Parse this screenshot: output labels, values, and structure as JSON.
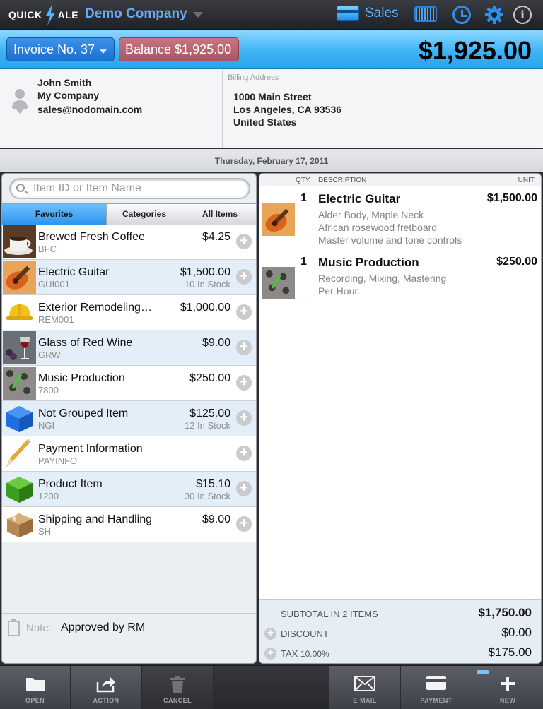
{
  "app": {
    "logo_left": "QUICK",
    "logo_right": "ALE",
    "company": "Demo Company",
    "mode_label": "Sales",
    "info_glyph": "i"
  },
  "invoice": {
    "number_label": "Invoice No. 37",
    "balance_label": "Balance $1,925.00",
    "total": "$1,925.00"
  },
  "customer": {
    "name": "John Smith",
    "company": "My Company",
    "email": "sales@nodomain.com",
    "billing_label": "Billing Address",
    "address_line1": "1000 Main Street",
    "address_line2": "Los Angeles, CA 93536",
    "address_line3": "United States"
  },
  "date": "Thursday, February 17, 2011",
  "search": {
    "placeholder": "Item ID or Item Name"
  },
  "tabs": [
    {
      "label": "Favorites",
      "active": true
    },
    {
      "label": "Categories",
      "active": false
    },
    {
      "label": "All Items",
      "active": false
    }
  ],
  "items": [
    {
      "name": "Brewed Fresh Coffee",
      "code": "BFC",
      "price": "$4.25",
      "stock": "",
      "icon": "coffee-icon"
    },
    {
      "name": "Electric Guitar",
      "code": "GUI001",
      "price": "$1,500.00",
      "stock": "10 In Stock",
      "icon": "guitar-icon"
    },
    {
      "name": "Exterior Remodeling…",
      "code": "REM001",
      "price": "$1,000.00",
      "stock": "",
      "icon": "hardhat-icon"
    },
    {
      "name": "Glass of Red Wine",
      "code": "GRW",
      "price": "$9.00",
      "stock": "",
      "icon": "wine-icon"
    },
    {
      "name": "Music Production",
      "code": "7800",
      "price": "$250.00",
      "stock": "",
      "icon": "mixer-icon"
    },
    {
      "name": "Not Grouped Item",
      "code": "NGI",
      "price": "$125.00",
      "stock": "12 In Stock",
      "icon": "blue-cube-icon"
    },
    {
      "name": "Payment Information",
      "code": "PAYINFO",
      "price": "",
      "stock": "",
      "icon": "pencil-icon"
    },
    {
      "name": "Product Item",
      "code": "1200",
      "price": "$15.10",
      "stock": "30 In Stock",
      "icon": "green-cube-icon"
    },
    {
      "name": "Shipping and Handling",
      "code": "SH",
      "price": "$9.00",
      "stock": "",
      "icon": "box-icon"
    }
  ],
  "add_glyph": "+",
  "note": {
    "label": "Note:",
    "value": "Approved by RM"
  },
  "lines_header": {
    "qty": "QTY",
    "description": "DESCRIPTION",
    "unit": "UNIT"
  },
  "lines": [
    {
      "qty": "1",
      "description": "Electric Guitar",
      "price": "$1,500.00",
      "details": [
        "Alder Body, Maple Neck",
        "African rosewood fretboard",
        "Master volume and tone controls"
      ],
      "icon": "guitar-icon"
    },
    {
      "qty": "1",
      "description": "Music Production",
      "price": "$250.00",
      "details": [
        "Recording, Mixing, Mastering",
        "Per Hour."
      ],
      "icon": "mixer-icon"
    }
  ],
  "totals": {
    "subtotal_label": "SUBTOTAL IN 2 ITEMS",
    "subtotal": "$1,750.00",
    "discount_label": "DISCOUNT",
    "discount": "$0.00",
    "tax_label": "TAX",
    "tax_rate": "10.00%",
    "tax": "$175.00"
  },
  "toolbar": {
    "open": "OPEN",
    "action": "ACTION",
    "cancel": "CANCEL",
    "email": "E-MAIL",
    "payment": "PAYMENT",
    "new": "NEW"
  },
  "colors": {
    "accent_blue": "#2c95ee",
    "balance_red": "#a85766",
    "toolbar": "#4a4d53"
  }
}
